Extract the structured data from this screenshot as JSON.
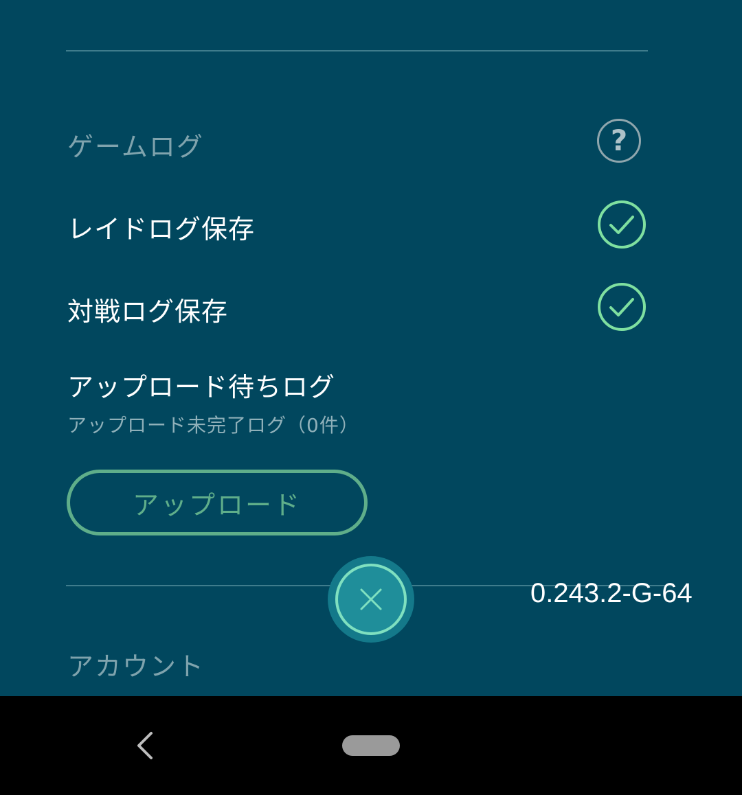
{
  "game_log": {
    "section_title": "ゲームログ",
    "help_icon": "help-circle-icon",
    "raid_log_label": "レイドログ保存",
    "raid_log_enabled": true,
    "battle_log_label": "対戦ログ保存",
    "battle_log_enabled": true,
    "pending_upload_label": "アップロード待ちログ",
    "pending_upload_sub": "アップロード未完了ログ（0件）",
    "upload_button_label": "アップロード"
  },
  "account": {
    "section_title": "アカウント"
  },
  "version_text": "0.243.2-G-64",
  "close_icon": "close-icon",
  "colors": {
    "background": "#01475e",
    "accent_green": "#7fe0a0",
    "button_green": "#5fae8a",
    "close_button": "#1f8e9a"
  },
  "nav": {
    "back_icon": "back-chevron-icon",
    "home_icon": "home-pill-icon"
  }
}
